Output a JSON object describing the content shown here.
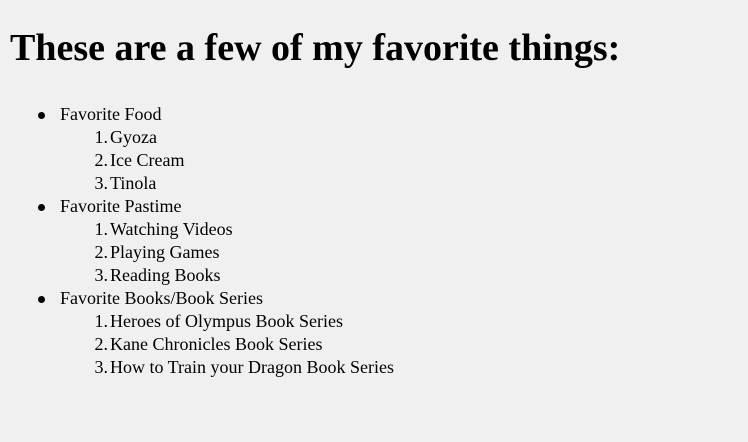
{
  "page": {
    "heading": "These are a few of my favorite things:"
  },
  "categories": [
    {
      "label": "Favorite Food",
      "items": [
        {
          "number": "1.",
          "label": "Gyoza"
        },
        {
          "number": "2.",
          "label": "Ice Cream"
        },
        {
          "number": "3.",
          "label": "Tinola"
        }
      ]
    },
    {
      "label": "Favorite Pastime",
      "items": [
        {
          "number": "1.",
          "label": "Watching Videos"
        },
        {
          "number": "2.",
          "label": "Playing Games"
        },
        {
          "number": "3.",
          "label": "Reading Books"
        }
      ]
    },
    {
      "label": "Favorite Books/Book Series",
      "items": [
        {
          "number": "1.",
          "label": "Heroes of Olympus Book Series"
        },
        {
          "number": "2.",
          "label": "Kane Chronicles Book Series"
        },
        {
          "number": "3.",
          "label": "How to Train your Dragon Book Series"
        }
      ]
    }
  ]
}
